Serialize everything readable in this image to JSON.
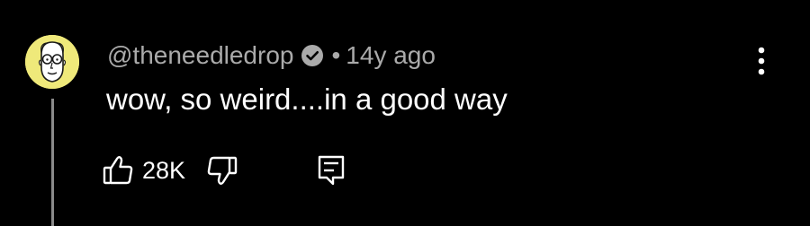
{
  "comment": {
    "author": "@theneedledrop",
    "separator": "•",
    "time_ago": "14y ago",
    "text": "wow, so weird....in a good way",
    "like_count": "28K"
  },
  "icons": {
    "avatar": "cartoon-face-avatar",
    "verified": "verified-check-icon",
    "menu": "more-vertical-icon",
    "like": "thumbs-up-icon",
    "dislike": "thumbs-down-icon",
    "reply": "reply-comment-icon"
  },
  "colors": {
    "background": "#000000",
    "primary_text": "#ffffff",
    "secondary_text": "#aaaaaa",
    "avatar_bg": "#efe97a",
    "thread_line": "#8a8a8a"
  }
}
